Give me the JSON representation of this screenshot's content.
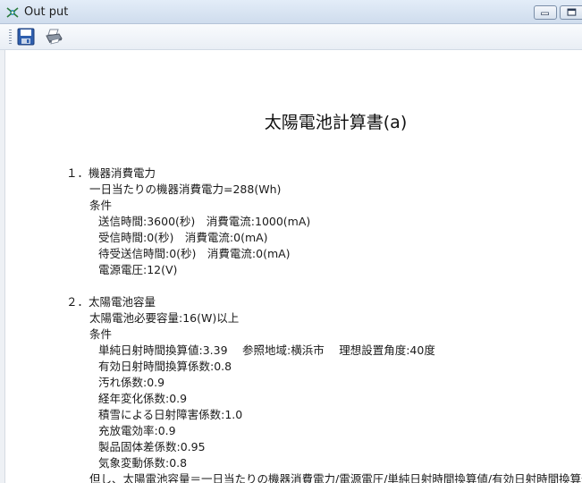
{
  "window": {
    "title": "Out put"
  },
  "toolbar": {
    "buttons": [
      {
        "name": "save",
        "icon": "floppy-disk-icon"
      },
      {
        "name": "print",
        "icon": "printer-icon"
      }
    ]
  },
  "document": {
    "title": "太陽電池計算書(a)",
    "section1": {
      "heading": "１．機器消費電力",
      "result": "一日当たりの機器消費電力=288(Wh)",
      "cond_label": "条件",
      "conditions": [
        "送信時間:3600(秒)　消費電流:1000(mA)",
        "受信時間:0(秒)　消費電流:0(mA)",
        "待受送信時間:0(秒)　消費電流:0(mA)",
        "電源電圧:12(V)"
      ]
    },
    "section2": {
      "heading": "２．太陽電池容量",
      "result": "太陽電池必要容量:16(W)以上",
      "cond_label": "条件",
      "conditions": [
        "単純日射時間換算値:3.39　 参照地域:横浜市　  理想設置角度:40度",
        "有効日射時間換算係数:0.8",
        "汚れ係数:0.9",
        "経年変化係数:0.9",
        "積雪による日射障害係数:1.0",
        "充放電効率:0.9",
        "製品固体差係数:0.95",
        "気象変動係数:0.8",
        "但し、太陽電池容量＝一日当たりの機器消費電力/電源電圧/単純日射時間換算値/有効日射時間換算係数"
      ]
    }
  },
  "colors": {
    "titlebar": "#d8e4f2",
    "text": "#1a1a1a"
  }
}
